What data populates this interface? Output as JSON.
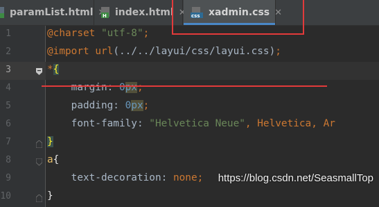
{
  "tabs": [
    {
      "label": "paramList.html",
      "close": "✕",
      "icon": "html-file-icon",
      "active": false
    },
    {
      "label": "index.html",
      "close": "✕",
      "icon": "html-file-icon",
      "active": false
    },
    {
      "label": "xadmin.css",
      "close": "✕",
      "icon": "css-file-icon",
      "active": true
    }
  ],
  "icon_labels": {
    "css": "css",
    "html": "H"
  },
  "colors": {
    "accent": "#4a88c7",
    "highlight": "#e23a3a",
    "keyword": "#cc7832",
    "string": "#6a8759",
    "number": "#6897bb"
  },
  "line_numbers": [
    "1",
    "2",
    "3",
    "4",
    "5",
    "6",
    "7",
    "8",
    "9",
    "10"
  ],
  "code": {
    "l1_kw": "@charset",
    "l1_str": "\"utf-8\"",
    "l1_semi": ";",
    "l2_kw": "@import",
    "l2_fn": "url",
    "l2_arg": "(../../layui/css/layui.css)",
    "l2_semi": ";",
    "l3_sel": "*",
    "l3_brace": "{",
    "l4_prop": "margin: ",
    "l4_num": "0",
    "l4_unit": "px",
    "l4_semi": ";",
    "l5_prop": "padding: ",
    "l5_num": "0",
    "l5_unit": "px",
    "l5_semi": ";",
    "l6_prop": "font-family: ",
    "l6_str": "\"Helvetica Neue\"",
    "l6_sep": ", ",
    "l6_kw1": "Helvetica",
    "l6_kw2": "Ar",
    "l7_brace": "}",
    "l8_sel": "a",
    "l8_brace": "{",
    "l9_prop": "text-decoration: ",
    "l9_val": "none",
    "l9_semi": ";",
    "l10_brace": "}"
  },
  "watermark": "https://blog.csdn.net/SeasmallTop"
}
